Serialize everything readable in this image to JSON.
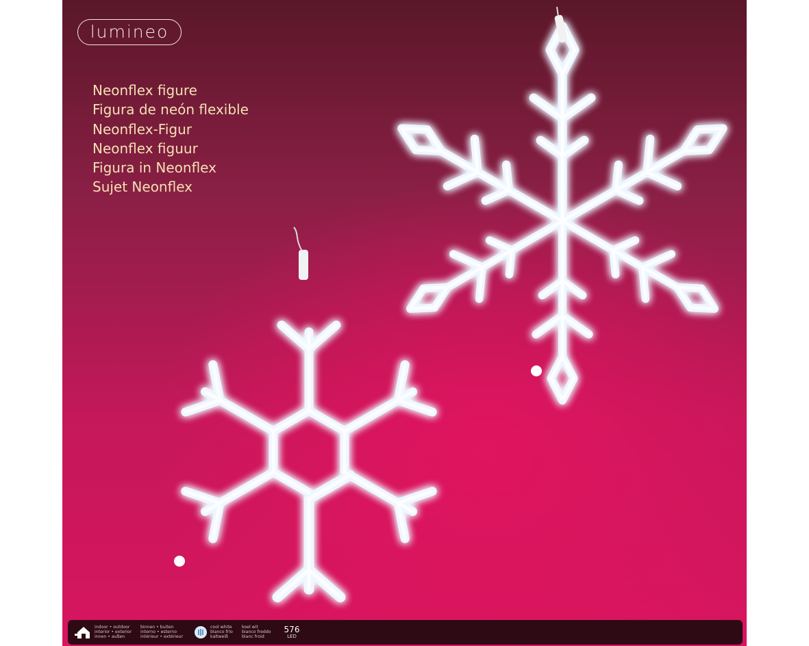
{
  "brand": {
    "logo_text": "lumineo"
  },
  "product_names": [
    "Neonflex figure",
    "Figura de neón flexible",
    "Neonflex-Figur",
    "Neonflex figuur",
    "Figura in Neonflex",
    "Sujet Neonflex"
  ],
  "info_bar": {
    "usage_lines": [
      "indoor • outdoor",
      "interior • exterior",
      "innen • außen"
    ],
    "usage_lines_2": [
      "binnen • buiten",
      "interno • esterno",
      "intérieur • extérieur"
    ],
    "color_lines": [
      "cool white",
      "blanco frío",
      "kaltweiß"
    ],
    "color_lines_2": [
      "koel wit",
      "bianco freddo",
      "blanc froid"
    ],
    "led_count": "576",
    "led_label": "LED"
  },
  "icons": {
    "usage": "indoor-outdoor-house-icon",
    "color": "cool-white-bulb-icon"
  },
  "colors": {
    "background_top": "#5a1729",
    "background_bottom": "#d8155f",
    "neon_glow": "#e8f4ff",
    "title_text": "#f4e0b4"
  }
}
